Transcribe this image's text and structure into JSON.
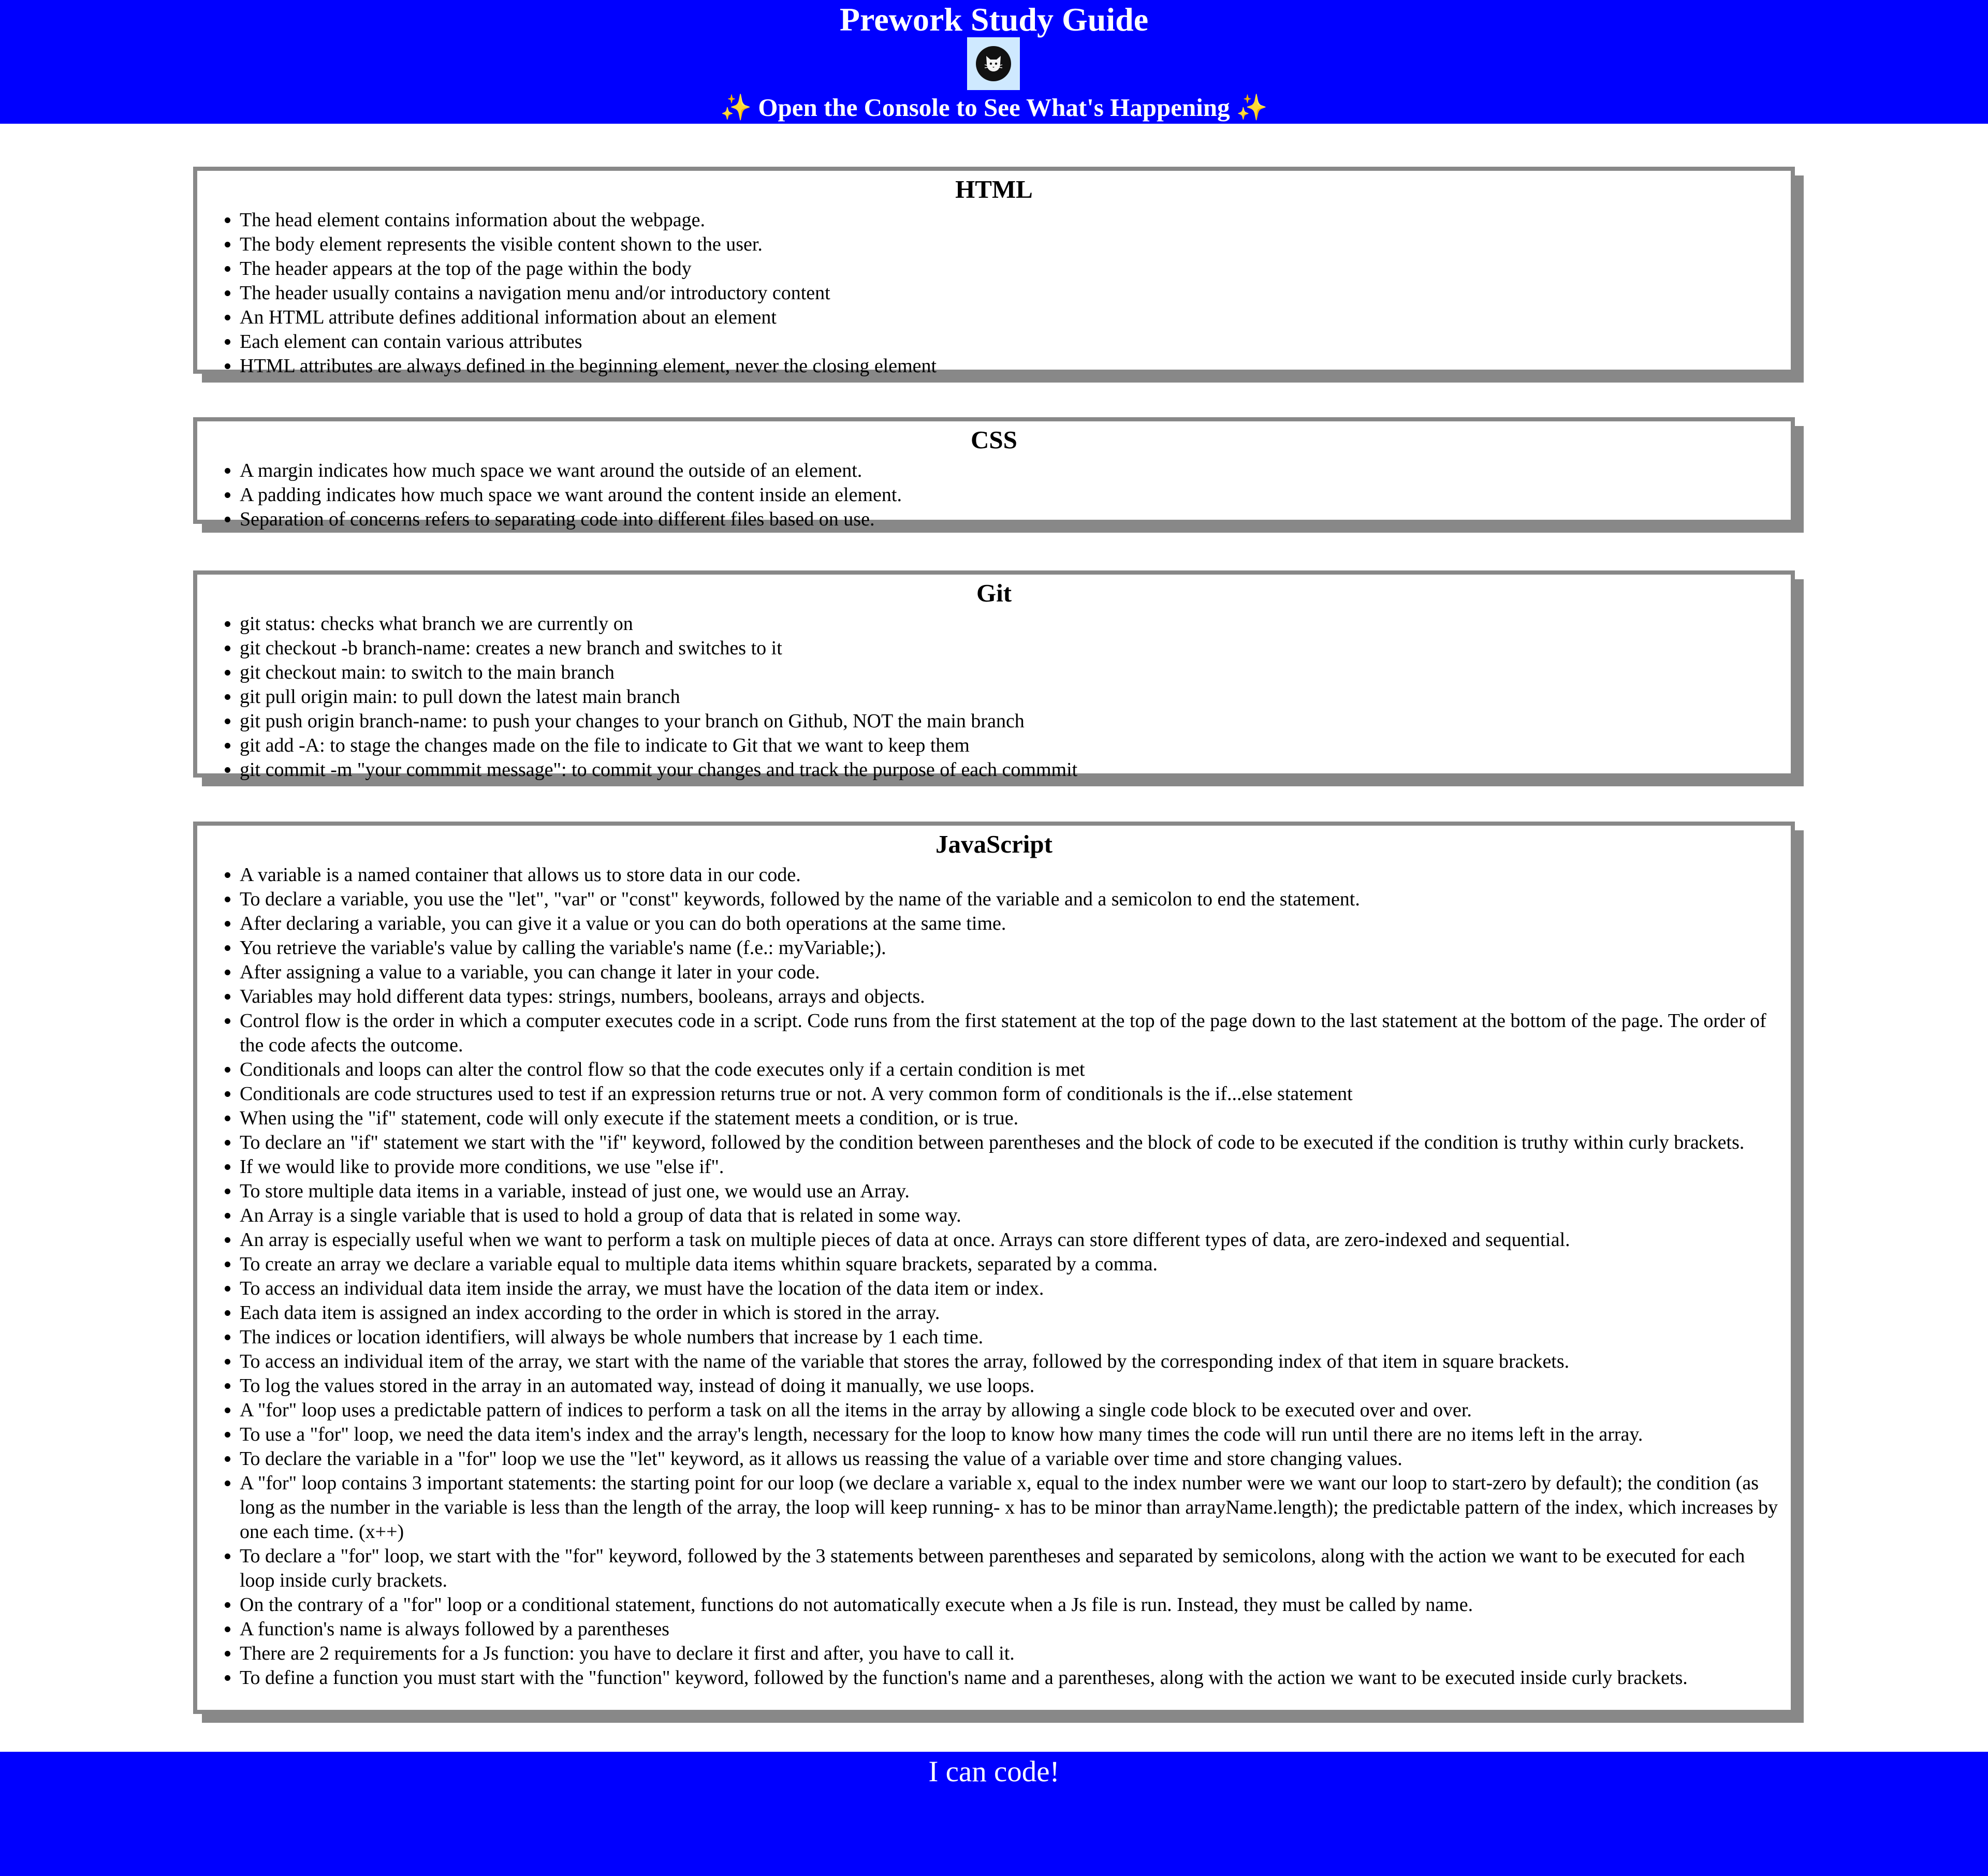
{
  "header": {
    "title": "Prework Study Guide",
    "console_text": "Open the Console to See What's Happening",
    "sparkle": "✨",
    "background_color": "#0000ff",
    "logo_icon": "cat-icon"
  },
  "sections": [
    {
      "title": "HTML",
      "items": [
        "The head element contains information about the webpage.",
        "The body element represents the visible content shown to the user.",
        "The header appears at the top of the page within the body",
        "The header usually contains a navigation menu and/or introductory content",
        "An HTML attribute defines additional information about an element",
        "Each element can contain various attributes",
        "HTML attributes are always defined in the beginning element, never the closing element"
      ]
    },
    {
      "title": "CSS",
      "items": [
        "A margin indicates how much space we want around the outside of an element.",
        "A padding indicates how much space we want around the content inside an element.",
        "Separation of concerns refers to separating code into different files based on use."
      ]
    },
    {
      "title": "Git",
      "items": [
        "git status: checks what branch we are currently on",
        "git checkout -b branch-name: creates a new branch and switches to it",
        "git checkout main: to switch to the main branch",
        "git pull origin main: to pull down the latest main branch",
        "git push origin branch-name: to push your changes to your branch on Github, NOT the main branch",
        "git add -A: to stage the changes made on the file to indicate to Git that we want to keep them",
        "git commit -m \"your commmit message\": to commit your changes and track the purpose of each commmit"
      ]
    },
    {
      "title": "JavaScript",
      "items": [
        "A variable is a named container that allows us to store data in our code.",
        "To declare a variable, you use the \"let\", \"var\" or \"const\" keywords, followed by the name of the variable and a semicolon to end the statement.",
        "After declaring a variable, you can give it a value or you can do both operations at the same time.",
        "You retrieve the variable's value by calling the variable's name (f.e.: myVariable;).",
        "After assigning a value to a variable, you can change it later in your code.",
        "Variables may hold different data types: strings, numbers, booleans, arrays and objects.",
        "Control flow is the order in which a computer executes code in a script. Code runs from the first statement at the top of the page down to the last statement at the bottom of the page. The order of the code afects the outcome.",
        "Conditionals and loops can alter the control flow so that the code executes only if a certain condition is met",
        "Conditionals are code structures used to test if an expression returns true or not. A very common form of conditionals is the if...else statement",
        "When using the \"if\" statement, code will only execute if the statement meets a condition, or is true.",
        "To declare an \"if\" statement we start with the \"if\" keyword, followed by the condition between parentheses and the block of code to be executed if the condition is truthy within curly brackets.",
        "If we would like to provide more conditions, we use \"else if\".",
        "To store multiple data items in a variable, instead of just one, we would use an Array.",
        "An Array is a single variable that is used to hold a group of data that is related in some way.",
        "An array is especially useful when we want to perform a task on multiple pieces of data at once. Arrays can store different types of data, are zero-indexed and sequential.",
        "To create an array we declare a variable equal to multiple data items whithin square brackets, separated by a comma.",
        "To access an individual data item inside the array, we must have the location of the data item or index.",
        "Each data item is assigned an index according to the order in which is stored in the array.",
        "The indices or location identifiers, will always be whole numbers that increase by 1 each time.",
        "To access an individual item of the array, we start with the name of the variable that stores the array, followed by the corresponding index of that item in square brackets.",
        "To log the values stored in the array in an automated way, instead of doing it manually, we use loops.",
        "A \"for\" loop uses a predictable pattern of indices to perform a task on all the items in the array by allowing a single code block to be executed over and over.",
        "To use a \"for\" loop, we need the data item's index and the array's length, necessary for the loop to know how many times the code will run until there are no items left in the array.",
        "To declare the variable in a \"for\" loop we use the \"let\" keyword, as it allows us reassing the value of a variable over time and store changing values.",
        "A \"for\" loop contains 3 important statements: the starting point for our loop (we declare a variable x, equal to the index number were we want our loop to start-zero by default); the condition (as long as the number in the variable is less than the length of the array, the loop will keep running- x has to be minor than arrayName.length); the predictable pattern of the index, which increases by one each time. (x++)",
        "To declare a \"for\" loop, we start with the \"for\" keyword, followed by the 3 statements between parentheses and separated by semicolons, along with the action we want to be executed for each loop inside curly brackets.",
        "On the contrary of a \"for\" loop or a conditional statement, functions do not automatically execute when a Js file is run. Instead, they must be called by name.",
        "A function's name is always followed by a parentheses",
        "There are 2 requirements for a Js function: you have to declare it first and after, you have to call it.",
        "To define a function you must start with the \"function\" keyword, followed by the function's name and a parentheses, along with the action we want to be executed inside curly brackets."
      ]
    }
  ],
  "footer": {
    "text": "I can code!"
  }
}
